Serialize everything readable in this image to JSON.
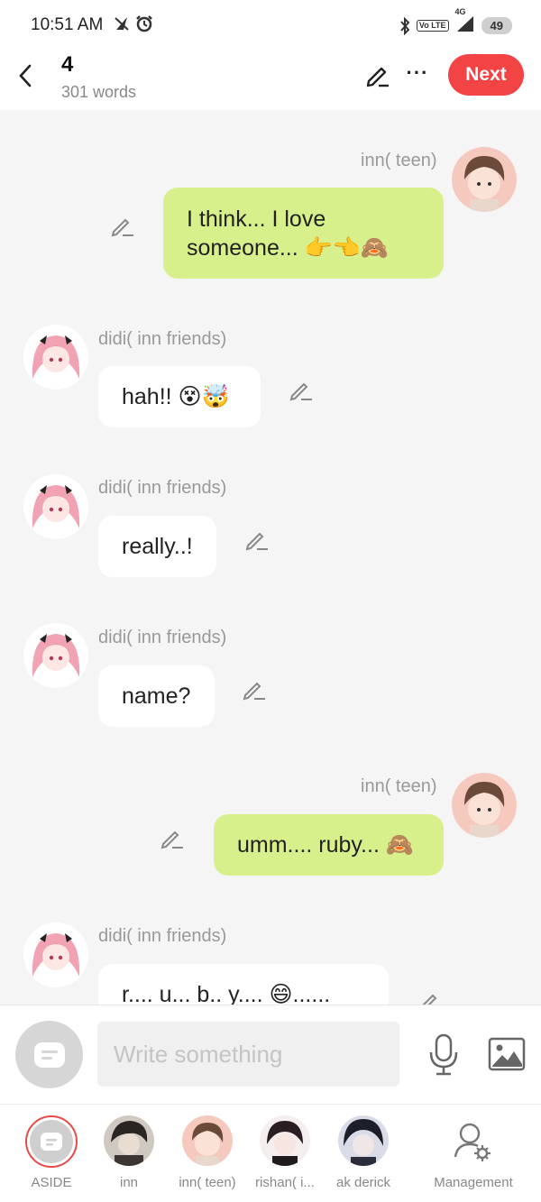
{
  "status_bar": {
    "time": "10:51 AM",
    "network": "4G",
    "volte": "Vo LTE",
    "battery": "49",
    "icons": [
      "nav-arrow-icon",
      "alarm-icon",
      "bluetooth-icon",
      "signal-icon",
      "battery-icon"
    ]
  },
  "header": {
    "title": "4",
    "word_count": "301 words",
    "next_label": "Next",
    "more_label": "···"
  },
  "messages": [
    {
      "side": "right",
      "sender": "inn( teen)",
      "text": "I think... I love someone... 👉👈🙈",
      "avatar": "boy-avatar"
    },
    {
      "side": "left",
      "sender": "didi( inn friends)",
      "text": "hah!! 😵🤯",
      "avatar": "girl-avatar"
    },
    {
      "side": "left",
      "sender": "didi( inn friends)",
      "text": "really..!",
      "avatar": "girl-avatar"
    },
    {
      "side": "left",
      "sender": "didi( inn friends)",
      "text": "name?",
      "avatar": "girl-avatar"
    },
    {
      "side": "right",
      "sender": "inn( teen)",
      "text": "umm.... ruby... 🙈",
      "avatar": "boy-avatar"
    },
    {
      "side": "left",
      "sender": "didi( inn friends)",
      "text": "r.... u... b.. y.... 😄......",
      "avatar": "girl-avatar"
    }
  ],
  "compose": {
    "placeholder": "Write something"
  },
  "tabs": [
    {
      "label": "ASIDE",
      "avatar": "aside-icon"
    },
    {
      "label": "inn",
      "avatar": "inn-avatar"
    },
    {
      "label": "inn( teen)",
      "avatar": "boy-avatar"
    },
    {
      "label": "rishan( i...",
      "avatar": "rishan-avatar"
    },
    {
      "label": "ak derick",
      "avatar": "derick-avatar"
    },
    {
      "label": "Management",
      "avatar": "management-icon"
    }
  ],
  "colors": {
    "accent": "#f24444",
    "bubble_self": "#d8f08c",
    "bubble_other": "#ffffff",
    "background": "#f5f5f5"
  }
}
